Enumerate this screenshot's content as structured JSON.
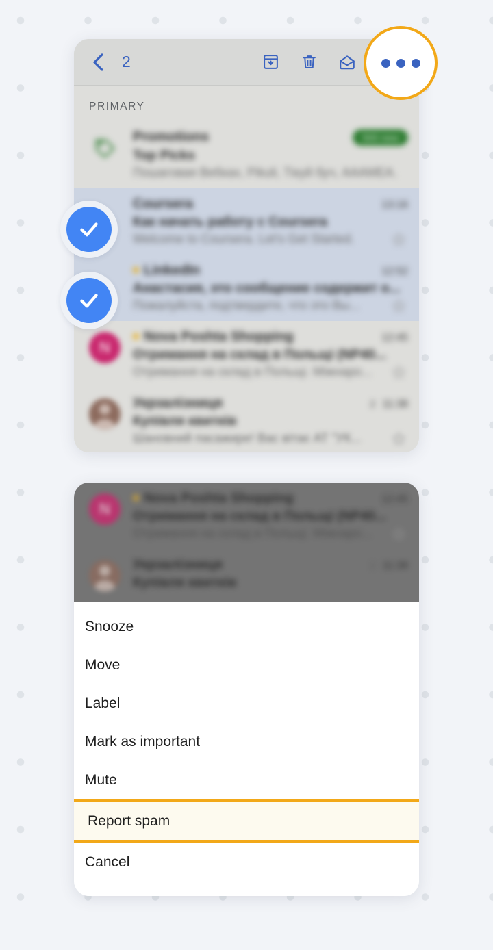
{
  "background": {
    "color": "#f2f4f8",
    "dot_color": "#dfe3e8"
  },
  "accent": {
    "highlight_border": "#f2a818",
    "highlight_fill": "#fdfaef",
    "blue": "#4285f4",
    "toolbar_blue": "#3a63c0"
  },
  "panel_top": {
    "toolbar": {
      "back_icon": "chevron-left-icon",
      "selected_count": "2",
      "actions": [
        {
          "icon": "archive-icon",
          "label": "Archive"
        },
        {
          "icon": "trash-icon",
          "label": "Delete"
        },
        {
          "icon": "mail-open-icon",
          "label": "Mark as read"
        },
        {
          "icon": "more-options-icon",
          "label": "More options"
        }
      ]
    },
    "section_label": "PRIMARY",
    "mail_rows": [
      {
        "avatar": "tag-icon",
        "avatar_type": "tag",
        "sender": "Promotions",
        "subject": "Top Picks",
        "snippet": "Пошаговая Вебках, Pikuli, Тікуй буч, АААМЕА.",
        "time": "",
        "badge": "500 new",
        "unread_dot": false,
        "selected": false,
        "blur": "strong"
      },
      {
        "avatar": "",
        "avatar_type": "none",
        "sender": "Coursera",
        "subject": "Как начать работу с Coursera",
        "snippet": "Welcome to Coursera. Let's Get Started.",
        "time": "13:16",
        "badge": "",
        "unread_dot": false,
        "selected": true,
        "blur": "strong"
      },
      {
        "avatar": "",
        "avatar_type": "none",
        "sender": "LinkedIn",
        "subject": "Анастасия, это сообщение содержит о...",
        "snippet": "Пожалуйста, подтвердите, что это Вы...",
        "time": "12:52",
        "badge": "",
        "unread_dot": true,
        "selected": true,
        "blur": "strong"
      },
      {
        "avatar": "N",
        "avatar_type": "nova",
        "sender": "Nova Poshta Shopping",
        "subject": "Отримання на склад в Польщі (NP40...",
        "snippet": "Отримання на склад в Польщі. Міжнаро...",
        "time": "12:45",
        "badge": "",
        "unread_dot": true,
        "selected": false,
        "blur": "strong"
      },
      {
        "avatar": "",
        "avatar_type": "person",
        "sender": "Укрзалізниця",
        "subject": "Купівля квитків",
        "snippet": "Шановний пасажире! Вас вітає АТ \"УК...",
        "time": "11:38",
        "badge": "",
        "msgcount": "2",
        "unread_dot": false,
        "selected": false,
        "blur": "mid"
      }
    ],
    "checkmarks": [
      {
        "name": "checkmark-coursera",
        "icon": "check-icon"
      },
      {
        "name": "checkmark-linkedin",
        "icon": "check-icon"
      }
    ]
  },
  "panel_bottom": {
    "scrim_rows": [
      {
        "avatar": "N",
        "avatar_type": "nova",
        "sender": "Nova Poshta Shopping",
        "subject": "Отримання на склад в Польщі (NP40...",
        "snippet": "Отримання на склад в Польщі. Міжнаро...",
        "time": "12:45",
        "unread_dot": true
      },
      {
        "avatar": "",
        "avatar_type": "person",
        "sender": "Укрзалізниця",
        "subject": "Купівля квитків",
        "snippet": "",
        "time": "11:38",
        "msgcount": "2",
        "unread_dot": false
      }
    ],
    "sheet_items": [
      {
        "label": "Snooze",
        "highlighted": false
      },
      {
        "label": "Move",
        "highlighted": false
      },
      {
        "label": "Label",
        "highlighted": false
      },
      {
        "label": "Mark as important",
        "highlighted": false
      },
      {
        "label": "Mute",
        "highlighted": false
      },
      {
        "label": "Report spam",
        "highlighted": true
      },
      {
        "label": "Cancel",
        "highlighted": false
      }
    ],
    "home_indicator": "home-indicator"
  }
}
